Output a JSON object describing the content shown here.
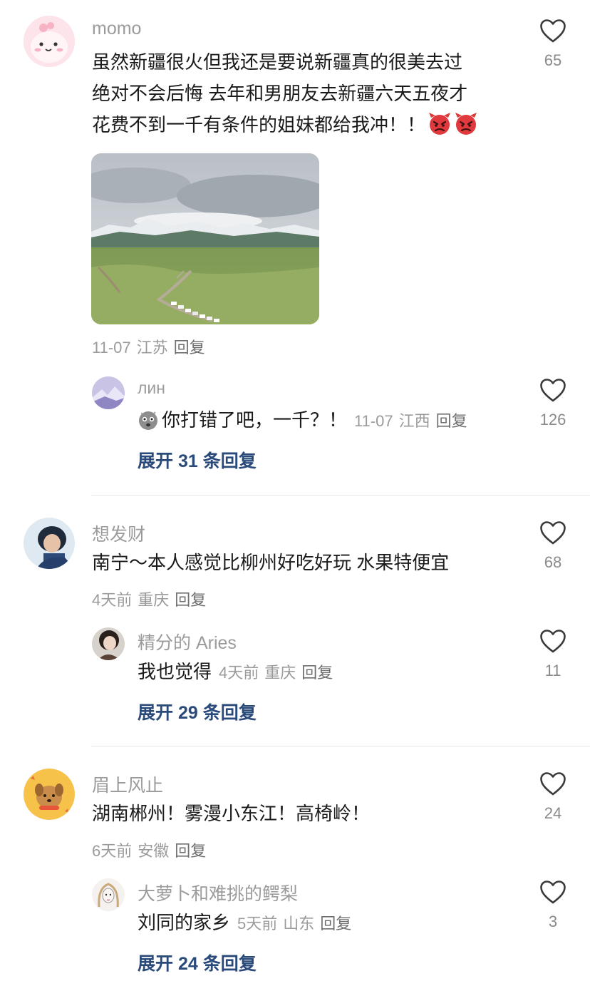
{
  "comments": [
    {
      "username": "momo",
      "lines": [
        "虽然新疆很火但我还是要说新疆真的很美去过",
        "绝对不会后悔 去年和男朋友去新疆六天五夜才",
        "花费不到一千有条件的姐妹都给我冲！！"
      ],
      "date": "11-07",
      "location": "江苏",
      "reply_label": "回复",
      "likes": "65",
      "reply": {
        "username": "лин",
        "text": "你打错了吧，一千？！",
        "date": "11-07",
        "location": "江西",
        "reply_label": "回复",
        "likes": "126"
      },
      "expand_label": "展开 31 条回复"
    },
    {
      "username": "想发财",
      "text": "南宁～本人感觉比柳州好吃好玩 水果特便宜",
      "date": "4天前",
      "location": "重庆",
      "reply_label": "回复",
      "likes": "68",
      "reply": {
        "username": "精分的 Aries",
        "text": "我也觉得",
        "date": "4天前",
        "location": "重庆",
        "reply_label": "回复",
        "likes": "11"
      },
      "expand_label": "展开 29 条回复"
    },
    {
      "username": "眉上风止",
      "text": "湖南郴州！雾漫小东江！高椅岭！",
      "date": "6天前",
      "location": "安徽",
      "reply_label": "回复",
      "likes": "24",
      "reply": {
        "username": "大萝卜和难挑的鳄梨",
        "text": "刘同的家乡",
        "date": "5天前",
        "location": "山东",
        "reply_label": "回复",
        "likes": "3"
      },
      "expand_label": "展开 24 条回复"
    }
  ],
  "colors": {
    "expand": "#2a4a7a",
    "meta": "#9b9b9b",
    "text": "#1a1a1a"
  },
  "icons": {
    "like": "heart-outline-icon",
    "emoji_angry": "angry-devil-emoji",
    "emoji_dust": "dust-face-emoji"
  }
}
